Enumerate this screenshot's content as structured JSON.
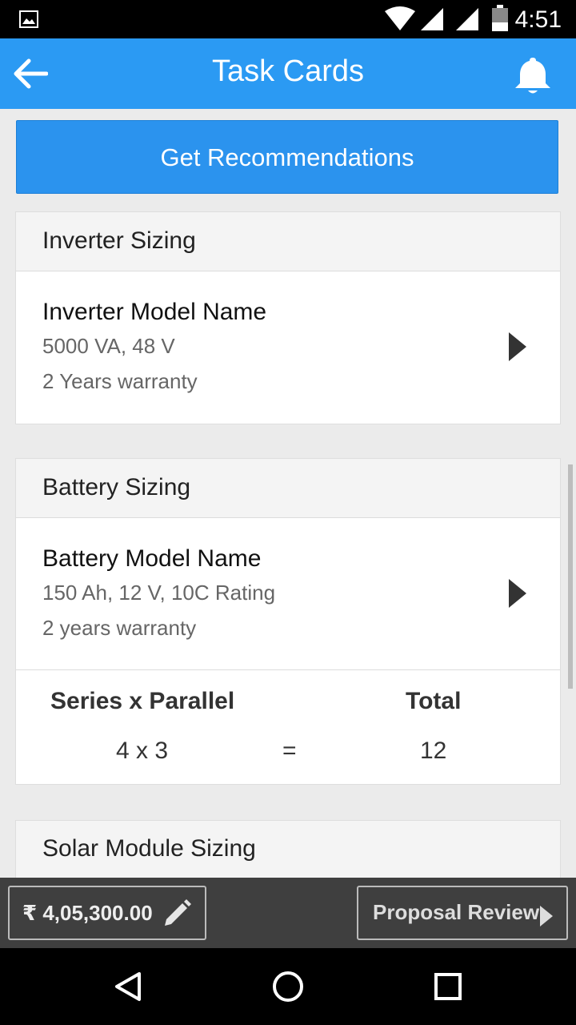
{
  "status_bar": {
    "time": "4:51",
    "icons": [
      "image-icon",
      "wifi-icon",
      "signal-icon",
      "signal-icon",
      "battery-icon"
    ]
  },
  "app_bar": {
    "title": "Task Cards",
    "back_icon": "arrow-left-icon",
    "notification_icon": "bell-icon"
  },
  "actions": {
    "get_recommendations": "Get Recommendations"
  },
  "cards": {
    "inverter": {
      "header": "Inverter Sizing",
      "model_name": "Inverter Model Name",
      "spec": "5000 VA, 48 V",
      "warranty": "2 Years warranty"
    },
    "battery": {
      "header": "Battery Sizing",
      "model_name": "Battery Model Name",
      "spec": "150 Ah, 12 V, 10C Rating",
      "warranty": "2 years warranty",
      "series_parallel_label": "Series x Parallel",
      "total_label": "Total",
      "series_parallel_value": "4 x 3",
      "equals": "=",
      "total_value": "12"
    },
    "solar": {
      "header": "Solar Module Sizing"
    }
  },
  "bottom_bar": {
    "price": "₹ 4,05,300.00",
    "proposal_review": "Proposal Review"
  },
  "nav_bar": {
    "icons": [
      "back-triangle-icon",
      "home-circle-icon",
      "recents-square-icon"
    ]
  },
  "colors": {
    "primary": "#2b9af3",
    "button": "#2b93ee",
    "background": "#ebebeb",
    "bottom_bar": "#3f3f3f"
  }
}
